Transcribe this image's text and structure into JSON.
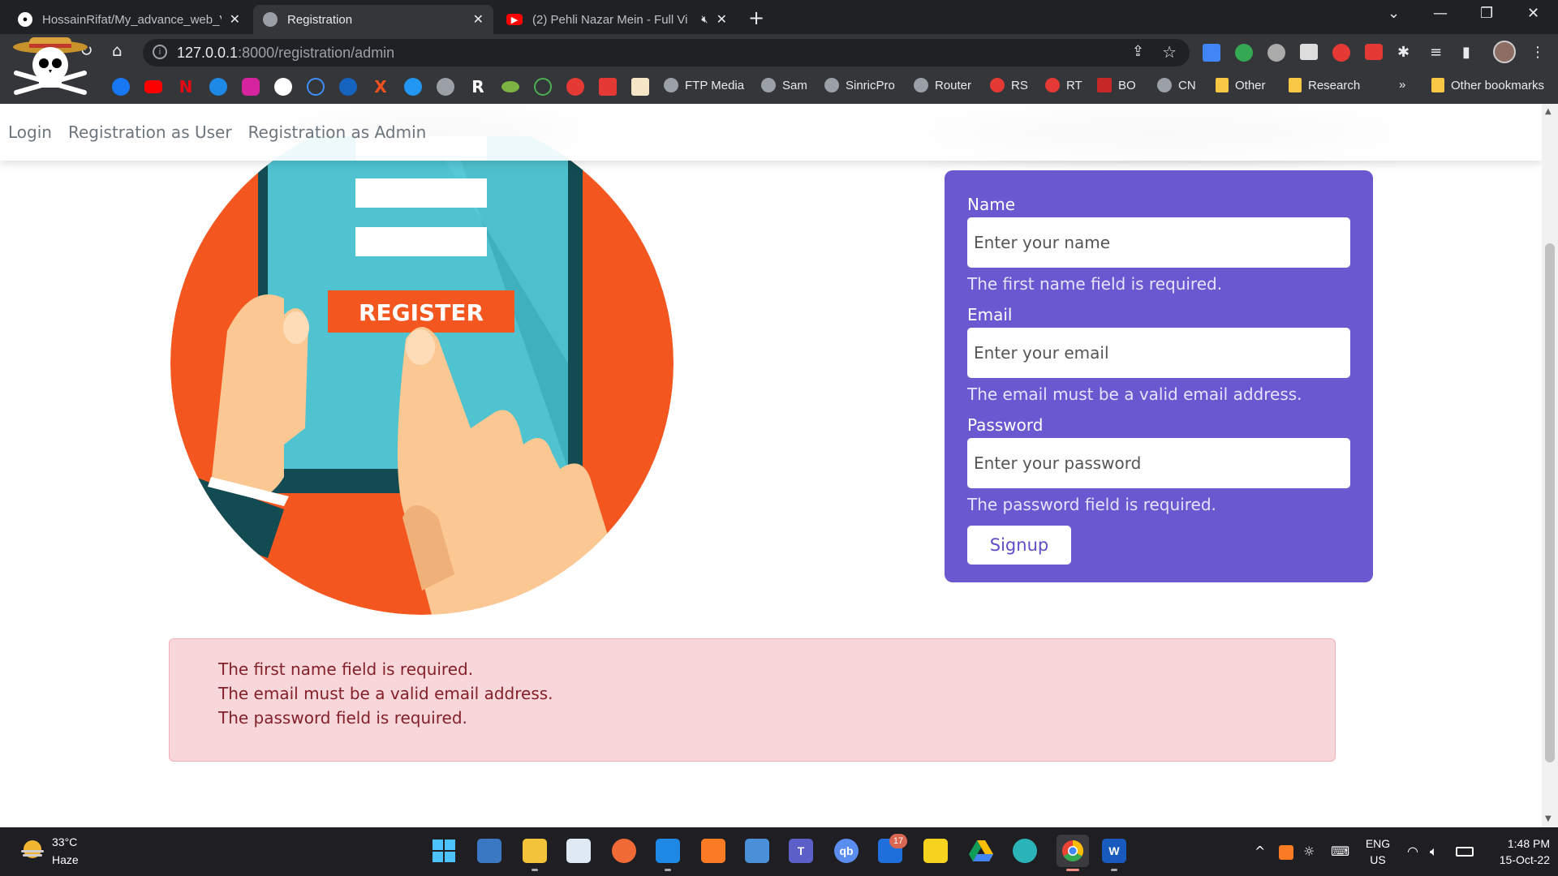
{
  "browser": {
    "tabs": [
      {
        "title": "HossainRifat/My_advance_web_V",
        "icon": "github-icon"
      },
      {
        "title": "Registration",
        "icon": "globe-icon"
      },
      {
        "title": "(2) Pehli Nazar Mein - Full Vi",
        "icon": "youtube-icon"
      }
    ],
    "url_host": "127.0.0.1",
    "url_path": ":8000/registration/admin",
    "bookmarks": [
      {
        "label": "FTP Media"
      },
      {
        "label": "Sam"
      },
      {
        "label": "SinricPro"
      },
      {
        "label": "Router"
      },
      {
        "label": "RS"
      },
      {
        "label": "RT"
      },
      {
        "label": "BO"
      },
      {
        "label": "CN"
      },
      {
        "label": "Other"
      },
      {
        "label": "Research"
      },
      {
        "label": "Other bookmarks"
      }
    ],
    "bookmarks_overflow": "»"
  },
  "nav": {
    "links": [
      "Login",
      "Registration as User",
      "Registration as Admin"
    ]
  },
  "illustration": {
    "button_text": "REGISTER"
  },
  "form": {
    "name_label": "Name",
    "name_placeholder": "Enter your name",
    "name_error": "The first name field is required.",
    "email_label": "Email",
    "email_placeholder": "Enter your email",
    "email_error": "The email must be a valid email address.",
    "password_label": "Password",
    "password_placeholder": "Enter your password",
    "password_error": "The password field is required.",
    "submit_label": "Signup"
  },
  "alert": {
    "errors": [
      "The first name field is required.",
      "The email must be a valid email address.",
      "The password field is required."
    ]
  },
  "taskbar": {
    "temperature": "33°C",
    "condition": "Haze",
    "teams_badge": "17",
    "language": "ENG",
    "region": "US",
    "time": "1:48 PM",
    "date": "15-Oct-22"
  },
  "colors": {
    "card": "#6a58d1",
    "alert_bg": "#f8d7da",
    "alert_text": "#842029",
    "illustration_orange": "#f4561f",
    "illustration_teal": "#4fc3d0"
  }
}
